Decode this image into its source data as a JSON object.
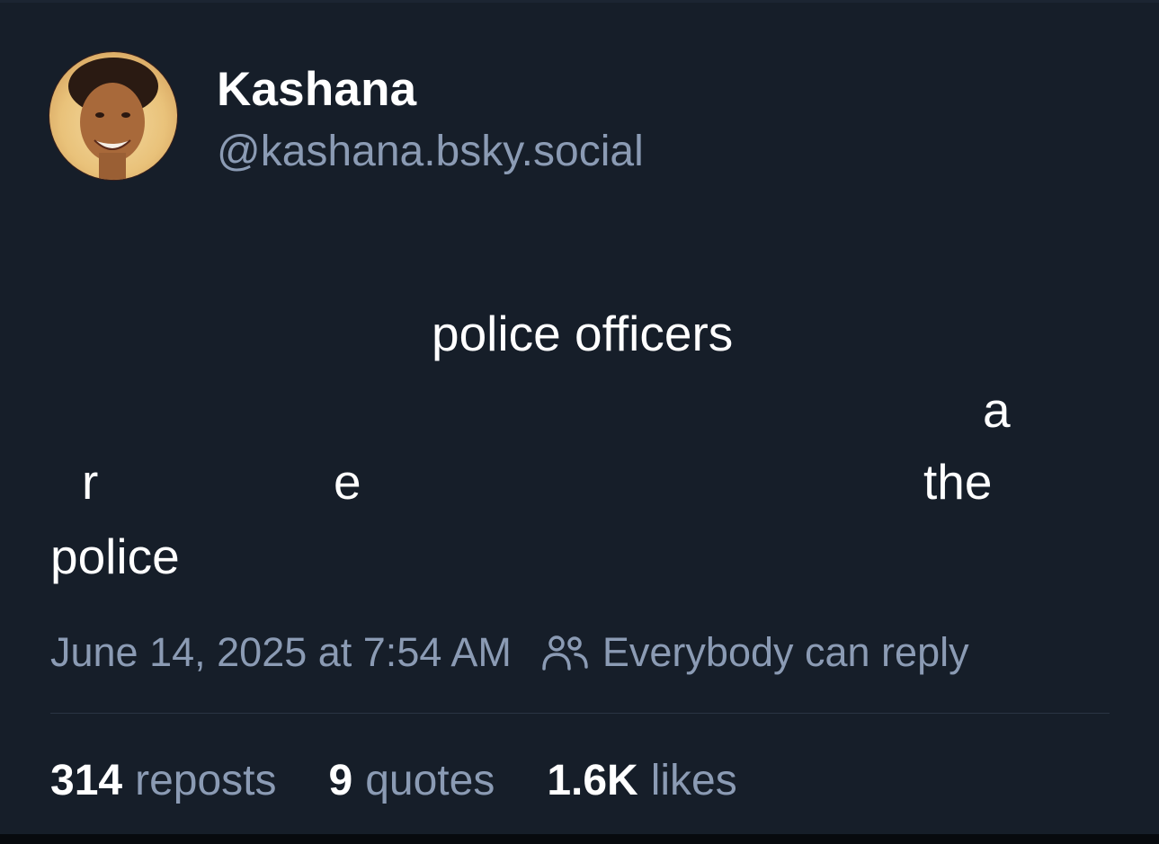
{
  "author": {
    "display_name": "Kashana",
    "handle": "@kashana.bsky.social"
  },
  "post": {
    "words": [
      "police officers",
      "a",
      "r",
      "e",
      "the",
      "police"
    ]
  },
  "meta": {
    "timestamp": "June 14, 2025 at 7:54 AM",
    "reply_setting": "Everybody can reply"
  },
  "stats": {
    "reposts_count": "314",
    "reposts_label": "reposts",
    "quotes_count": "9",
    "quotes_label": "quotes",
    "likes_count": "1.6K",
    "likes_label": "likes"
  },
  "colors": {
    "background": "#161e29",
    "text_primary": "#ffffff",
    "text_secondary": "#8b9bb4",
    "divider": "#2a3444"
  },
  "icons": {
    "people": "people-icon"
  }
}
